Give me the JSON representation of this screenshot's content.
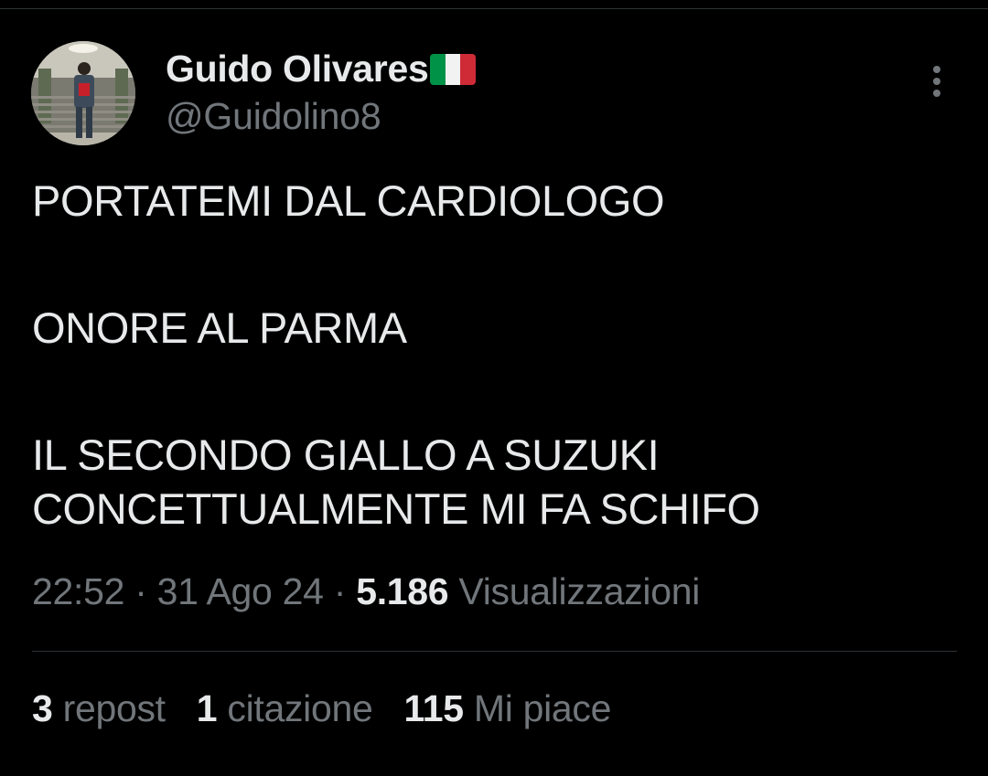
{
  "author": {
    "display_name": "Guido Olivares",
    "flag_icon": "italy-flag-icon",
    "handle": "@Guidolino8"
  },
  "tweet": {
    "paragraphs": [
      "PORTATEMI DAL CARDIOLOGO",
      "ONORE AL PARMA",
      "IL SECONDO GIALLO A SUZUKI CONCETTUALMENTE MI FA SCHIFO"
    ]
  },
  "meta": {
    "time": "22:52",
    "separator": " · ",
    "date": "31 Ago 24",
    "views_count": "5.186",
    "views_label": " Visualizzazioni"
  },
  "stats": {
    "reposts_count": "3",
    "reposts_label": " repost",
    "quotes_count": "1",
    "quotes_label": " citazione",
    "likes_count": "115",
    "likes_label": " Mi piace"
  },
  "icons": {
    "more": "more-vertical-icon"
  },
  "colors": {
    "background": "#000000",
    "primary_text": "#e7e9ea",
    "secondary_text": "#71767b",
    "divider": "#2f3336",
    "flag_green": "#009246",
    "flag_white": "#f1f2f1",
    "flag_red": "#ce2b37"
  }
}
